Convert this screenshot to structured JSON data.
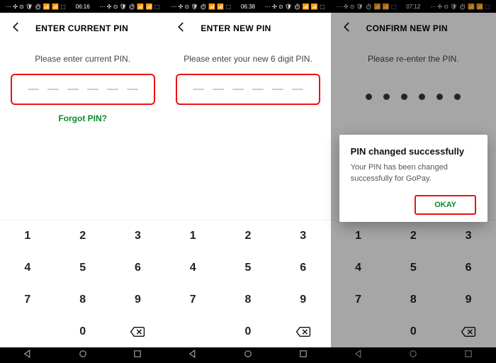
{
  "screens": [
    {
      "time": "06:16",
      "title": "ENTER CURRENT PIN",
      "prompt": "Please enter current PIN.",
      "forgot": "Forgot PIN?",
      "pin_style": "dash",
      "show_forgot": true
    },
    {
      "time": "06:38",
      "title": "ENTER NEW PIN",
      "prompt": "Please enter your new 6 digit PIN.",
      "pin_style": "dash",
      "show_forgot": false
    },
    {
      "time": "07:12",
      "title": "CONFIRM NEW PIN",
      "prompt": "Please re-enter the PIN.",
      "pin_style": "dot",
      "show_forgot": false,
      "dimmed": true,
      "dialog": {
        "heading": "PIN changed successfully",
        "body": "Your PIN has been changed successfully for GoPay.",
        "ok": "OKAY"
      }
    }
  ],
  "keypad": [
    "1",
    "2",
    "3",
    "4",
    "5",
    "6",
    "7",
    "8",
    "9",
    "",
    "0",
    "del"
  ]
}
